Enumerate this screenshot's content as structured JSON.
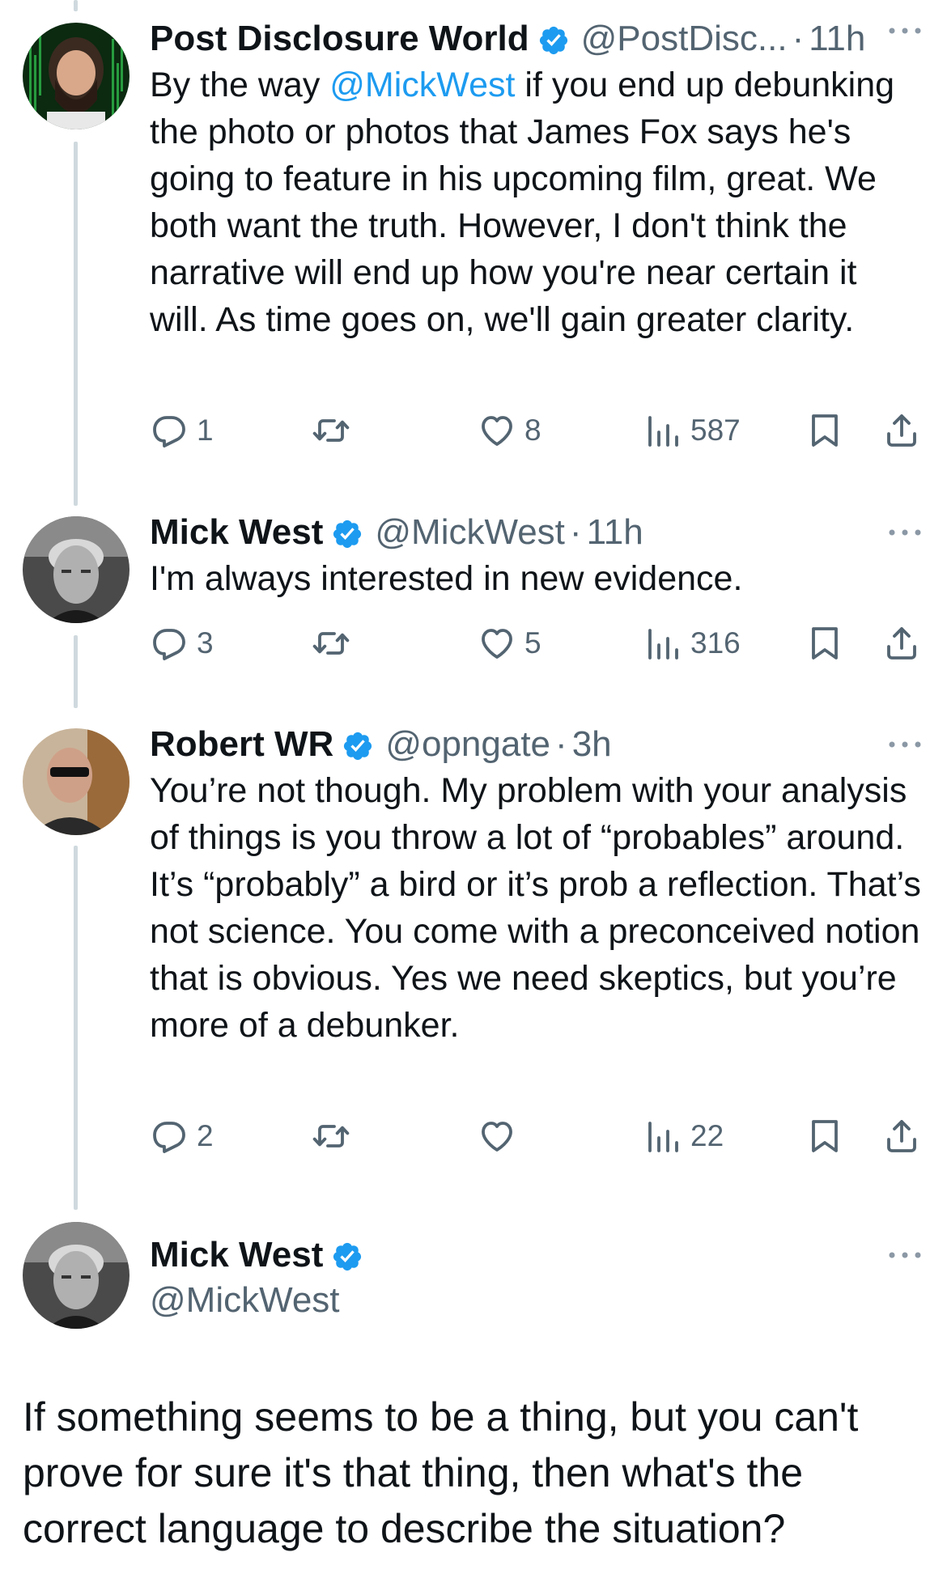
{
  "tweets": [
    {
      "name": "Post Disclosure World",
      "handle": "@PostDisc...",
      "separator": "·",
      "time": "11h",
      "text_before": "By the way ",
      "mention": "@MickWest",
      "text_after": " if you end up debunking the photo or photos that James Fox says he's going to feature in his upcoming film, great. We both want the truth. However, I don't think the narrative will end up how you're near certain it will. As time goes on, we'll gain greater clarity.",
      "replies": "1",
      "retweets": "",
      "likes": "8",
      "views": "587"
    },
    {
      "name": "Mick West",
      "handle": "@MickWest",
      "separator": "·",
      "time": "11h",
      "text": "I'm always interested in new evidence.",
      "replies": "3",
      "retweets": "",
      "likes": "5",
      "views": "316"
    },
    {
      "name": "Robert WR",
      "handle": "@opngate",
      "separator": "·",
      "time": "3h",
      "text": "You’re not though. My problem with your analysis of things is you throw a lot of “probables” around. It’s “probably” a bird or it’s prob a reflection. That’s not science. You come with a preconceived notion that is obvious. Yes we need skeptics, but you’re more of a debunker.",
      "replies": "2",
      "retweets": "",
      "likes": "",
      "views": "22"
    }
  ],
  "main_tweet": {
    "name": "Mick West",
    "handle": "@MickWest",
    "text": "If something seems to be a thing, but you can't prove for sure it's that thing, then what's the correct language to describe the situation?"
  },
  "colors": {
    "verified": "#1d9bf0",
    "mention": "#1d9bf0",
    "secondary_text": "#536471",
    "thread_line": "#cfd9de"
  },
  "icons": [
    "verified-badge-icon",
    "more-icon",
    "reply-icon",
    "retweet-icon",
    "like-icon",
    "views-icon",
    "bookmark-icon",
    "share-icon"
  ]
}
